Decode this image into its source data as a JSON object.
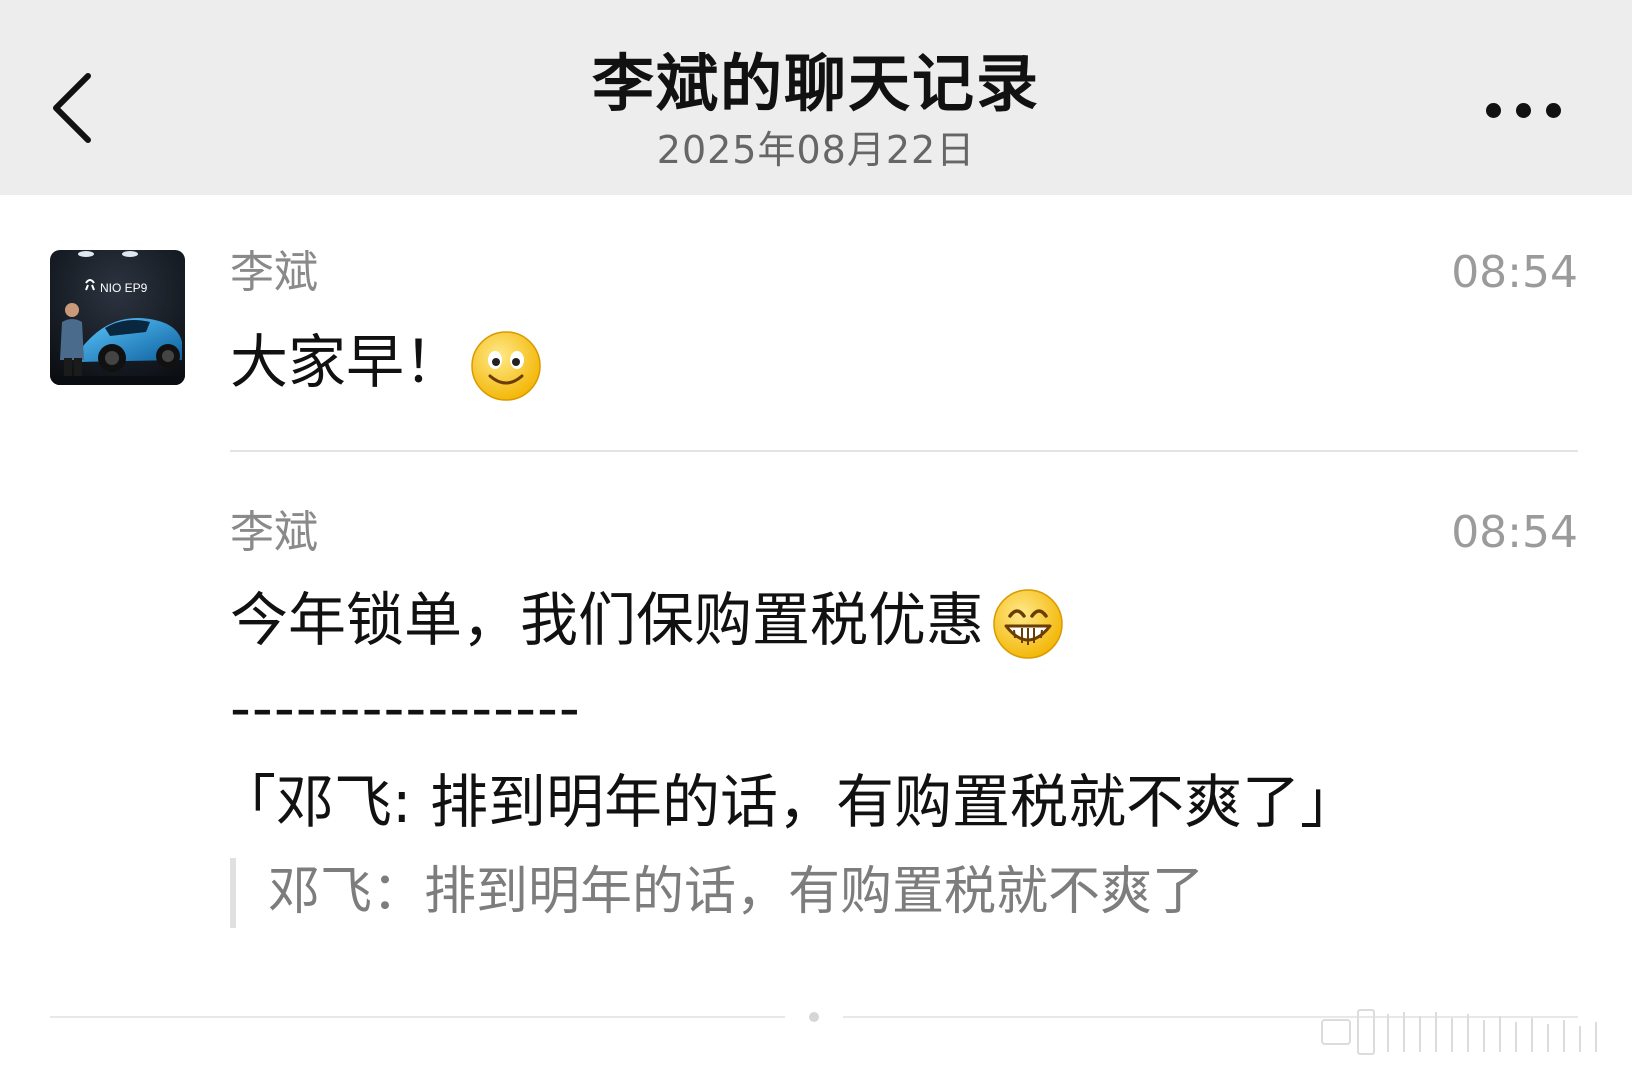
{
  "header": {
    "title": "李斌的聊天记录",
    "date": "2025年08月22日"
  },
  "avatar": {
    "brand_text": "NIO EP9"
  },
  "messages": [
    {
      "sender": "李斌",
      "time": "08:54",
      "text": "大家早！",
      "emoji": "smile-emoji"
    },
    {
      "sender": "李斌",
      "time": "08:54",
      "text": "今年锁单，我们保购置税优惠",
      "emoji": "grin-emoji",
      "separator": "----------------",
      "reply_text": "「邓飞: 排到明年的话，有购置税就不爽了」",
      "quote": "邓飞：排到明年的话，有购置税就不爽了"
    }
  ],
  "colors": {
    "header_bg": "#ededed",
    "title": "#111111",
    "meta_gray": "#8a8a8a",
    "divider": "#e3e3e3"
  }
}
